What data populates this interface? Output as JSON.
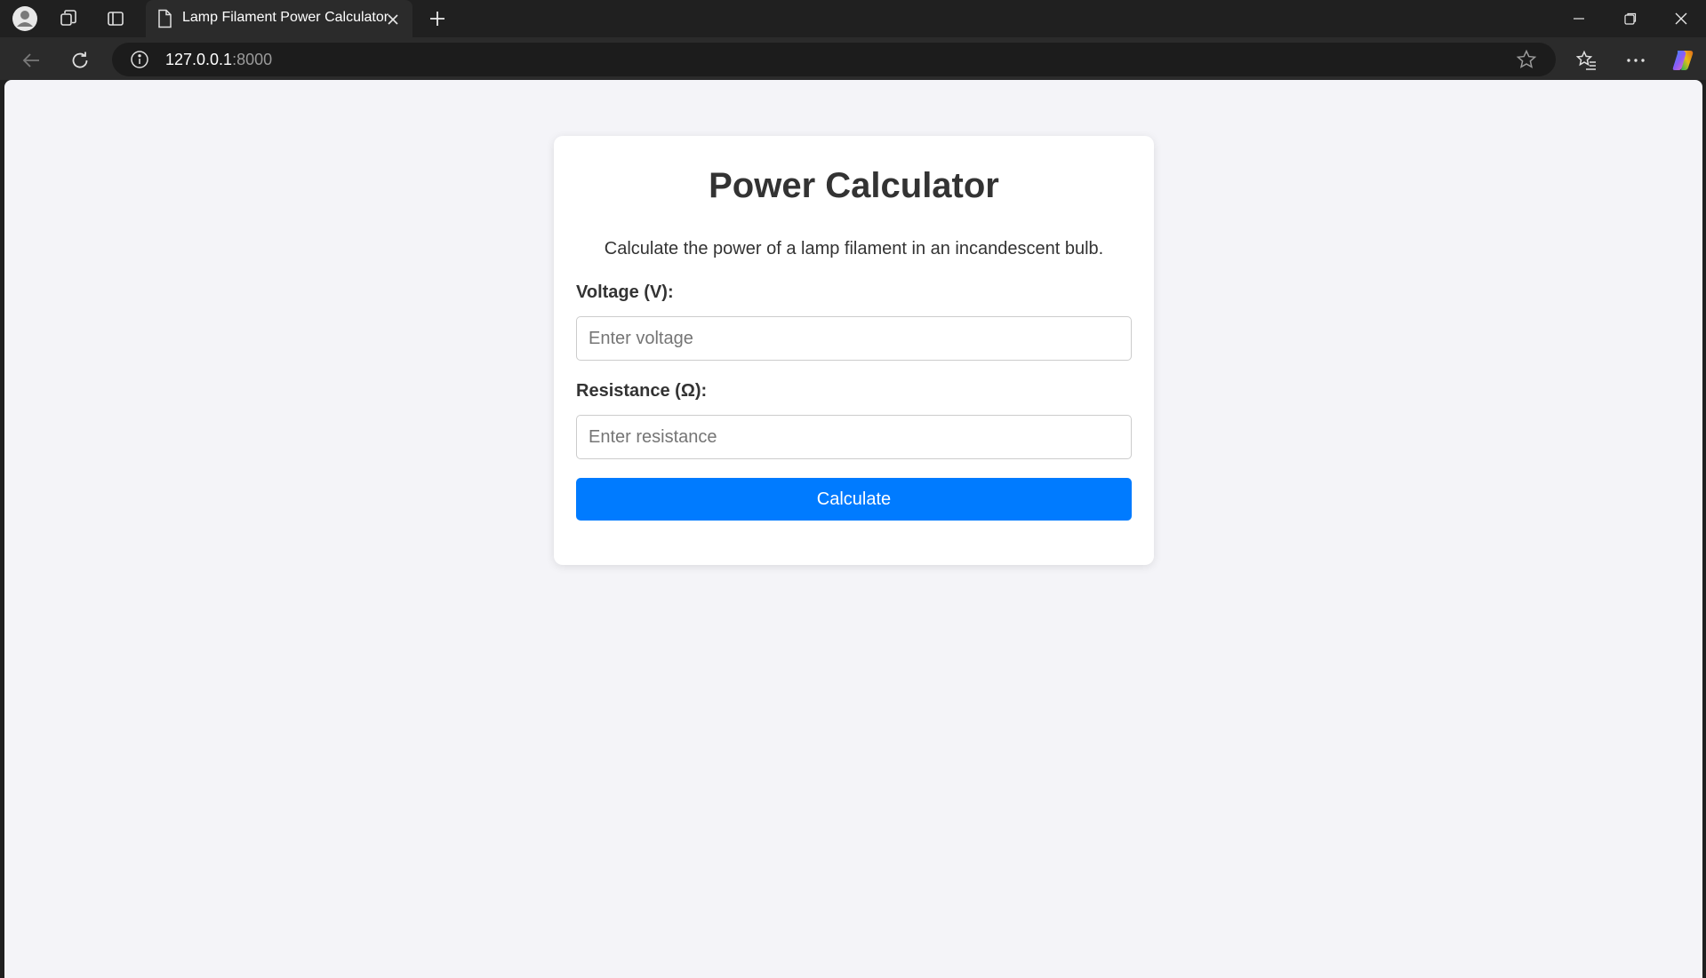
{
  "browser": {
    "tab_title": "Lamp Filament Power Calculator",
    "url_host": "127.0.0.1",
    "url_port": ":8000"
  },
  "page": {
    "title": "Power Calculator",
    "description": "Calculate the power of a lamp filament in an incandescent bulb.",
    "voltage_label": "Voltage (V):",
    "voltage_placeholder": "Enter voltage",
    "voltage_value": "",
    "resistance_label": "Resistance (Ω):",
    "resistance_placeholder": "Enter resistance",
    "resistance_value": "",
    "calculate_label": "Calculate"
  },
  "colors": {
    "accent": "#007bff",
    "page_background": "#f4f4f8",
    "card_background": "#ffffff",
    "text": "#333333"
  }
}
